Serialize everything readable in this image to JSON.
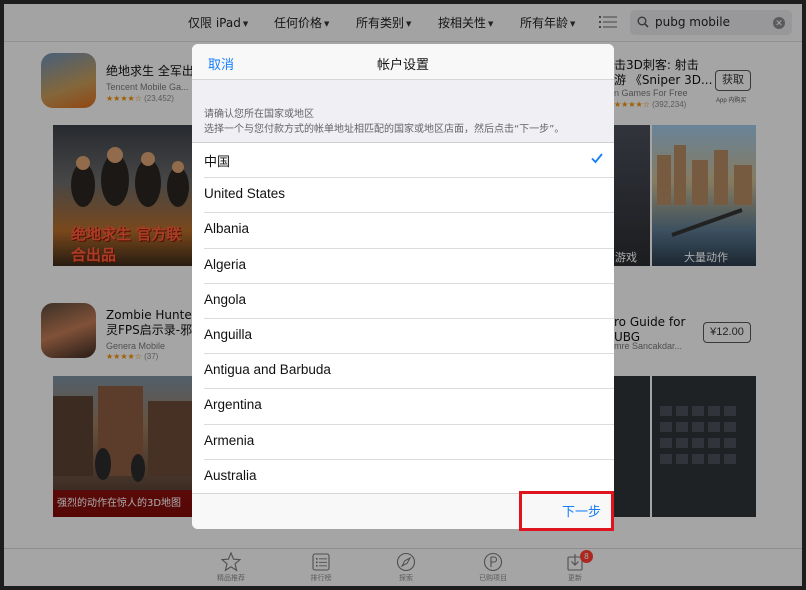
{
  "filters": {
    "device": "仅限 iPad",
    "price": "任何价格",
    "category": "所有类别",
    "sort": "按相关性",
    "age": "所有年龄"
  },
  "search": {
    "query": "pubg mobile"
  },
  "apps": [
    {
      "name_line1": "绝地求生 全军出击",
      "developer": "Tencent Mobile Ga...",
      "rating_count": "(23,452)",
      "shot_caption": "绝地求生 官方联合出品"
    },
    {
      "name_line1": "Zombie Hunter: 亡",
      "name_line2": "灵FPS启示录-邪...",
      "developer": "Genera Mobile",
      "rating_count": "(37)",
      "shot_caption": "强烈的动作在惊人的3D地图"
    }
  ],
  "right_apps": [
    {
      "name_line1": "击3D刺客: 射击",
      "name_line2": "游 《Sniper 3D...",
      "developer": "n Games For Free",
      "rating_count": "(392,234)",
      "button": "获取",
      "note": "App 内购买",
      "shot_caption_a": "游戏",
      "shot_caption_b": "大量动作"
    },
    {
      "name_line1": "ro Guide for",
      "name_line2": "UBG",
      "developer": "mre Sancakdar...",
      "button": "¥12.00"
    }
  ],
  "modal": {
    "cancel": "取消",
    "title": "帐户设置",
    "hint_line1": "请确认您所在国家或地区",
    "hint_line2": "选择一个与您付款方式的帐单地址相匹配的国家或地区店面，然后点击“下一步”。",
    "countries": [
      "中国",
      "United States",
      "Albania",
      "Algeria",
      "Angola",
      "Anguilla",
      "Antigua and Barbuda",
      "Argentina",
      "Armenia",
      "Australia"
    ],
    "selected": "中国",
    "next": "下一步"
  },
  "tabs": [
    {
      "label": "精品推荐",
      "icon": "star-icon"
    },
    {
      "label": "排行榜",
      "icon": "list-icon"
    },
    {
      "label": "探索",
      "icon": "compass-icon"
    },
    {
      "label": "已购项目",
      "icon": "purchased-icon"
    },
    {
      "label": "更新",
      "icon": "download-icon",
      "badge": "8"
    }
  ],
  "colors": {
    "accent": "#147efb",
    "highlight": "#e0141e",
    "stars": "#f08c00"
  }
}
